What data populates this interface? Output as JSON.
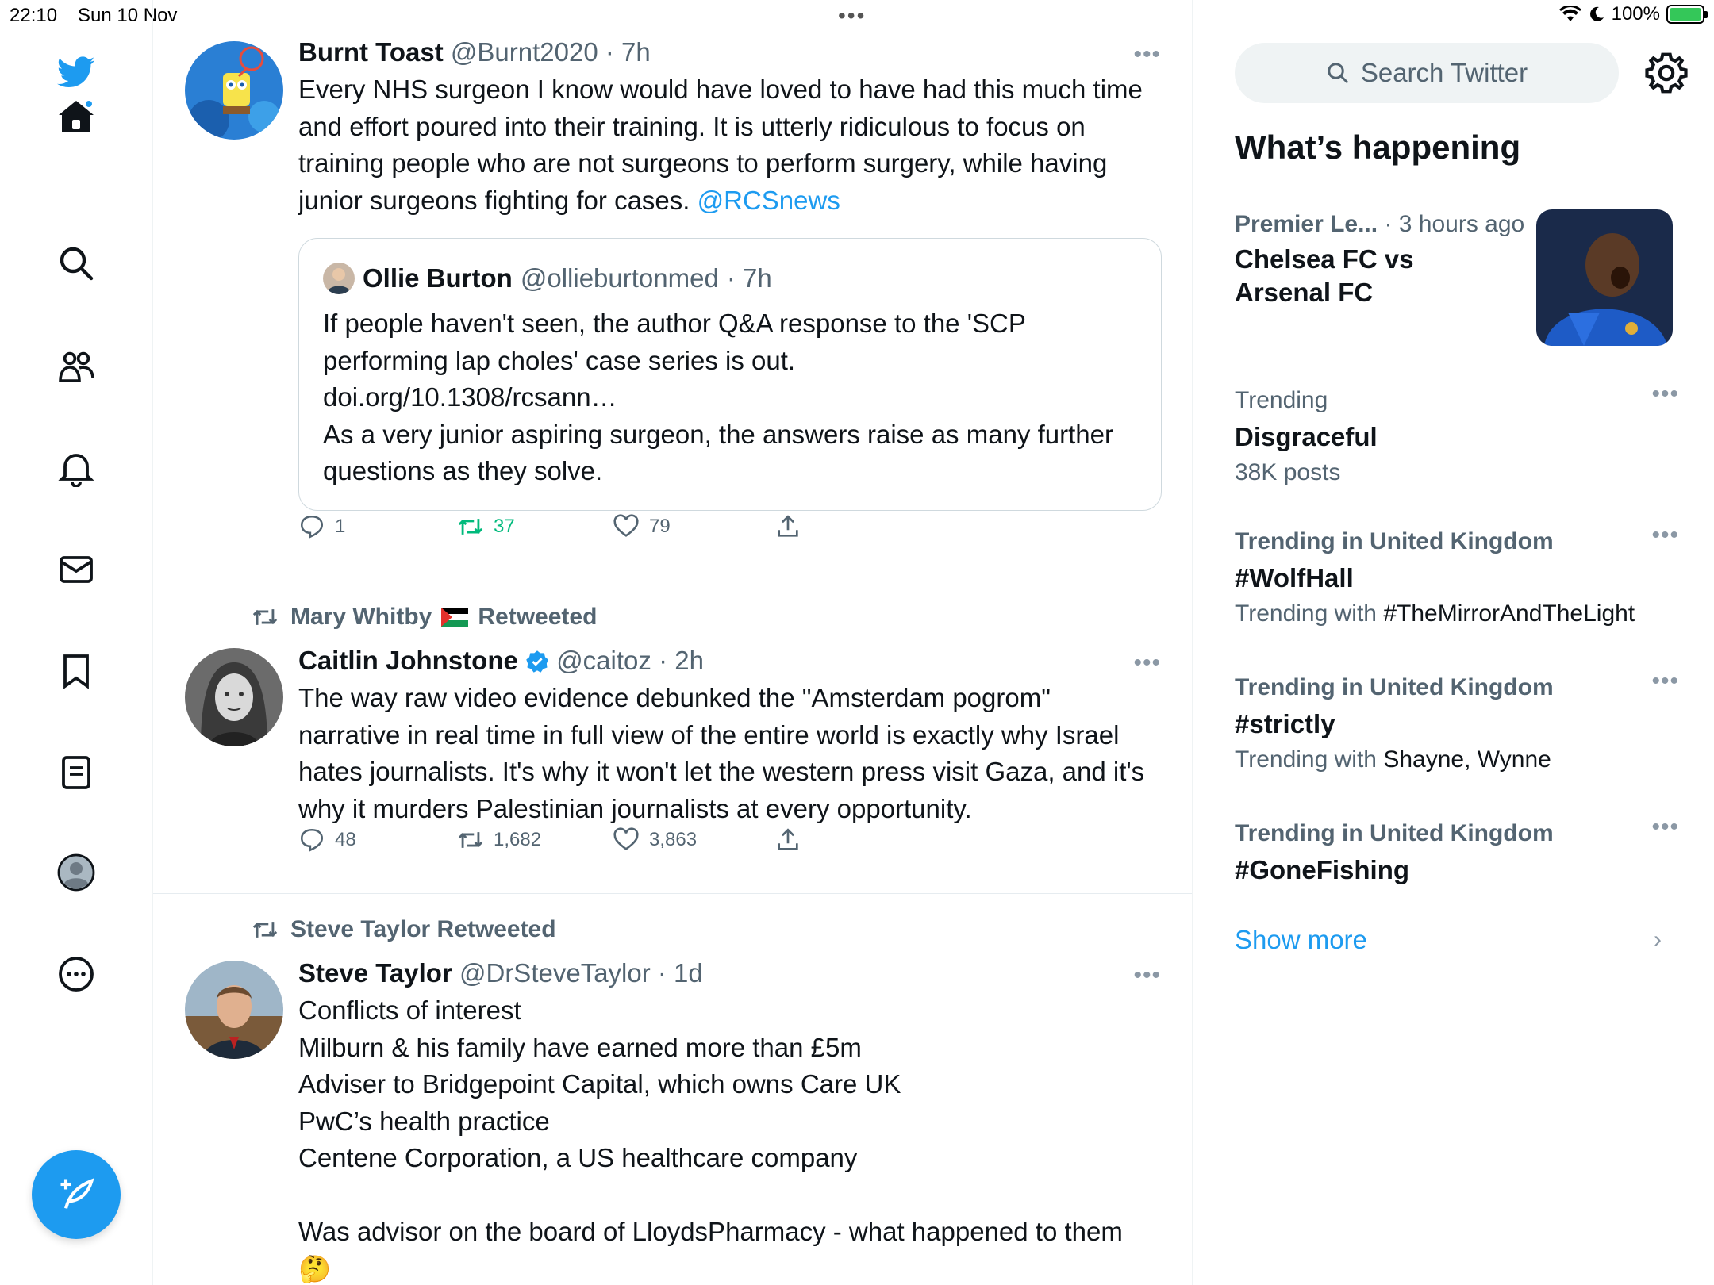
{
  "status_bar": {
    "time": "22:10",
    "date": "Sun 10 Nov",
    "battery": "100%"
  },
  "nav": {
    "icons": [
      "twitter-logo-icon",
      "home-icon",
      "search-icon",
      "communities-icon",
      "notifications-icon",
      "messages-icon",
      "bookmarks-icon",
      "lists-icon",
      "profile-icon",
      "more-icon"
    ],
    "compose_icon": "compose-icon",
    "accent": "#1d9bf0"
  },
  "timeline": {
    "tweets": [
      {
        "name": "Burnt Toast",
        "handle": "@Burnt2020",
        "time": "· 7h",
        "text": "Every NHS surgeon I know would have loved to have had this much time and effort poured into their training. It is utterly ridiculous to focus on training people who are not surgeons to perform surgery, while having junior surgeons fighting for cases.",
        "mention": "@RCSnews",
        "quote": {
          "name": "Ollie Burton",
          "handle": "@ollieburtonmed",
          "time": "· 7h",
          "line1": "If people haven't seen, the author Q&A response to the 'SCP performing lap choles' case series is out.",
          "line2": "doi.org/10.1308/rcsann…",
          "line3": "As a very junior aspiring surgeon, the answers raise as many further questions as they solve."
        },
        "replies": "1",
        "retweets": "37",
        "likes": "79"
      },
      {
        "retweeted_by": "Mary Whitby",
        "retweeted_label": "Retweeted",
        "name": "Caitlin Johnstone",
        "handle": "@caitoz",
        "time": "· 2h",
        "text": "The way raw video evidence debunked the \"Amsterdam pogrom\" narrative in real time in full view of the entire world is exactly why Israel hates journalists. It's why it won't let the western press visit Gaza, and it's why it murders Palestinian journalists at every opportunity.",
        "replies": "48",
        "retweets": "1,682",
        "likes": "3,863"
      },
      {
        "retweeted_by": "Steve Taylor Retweeted",
        "name": "Steve Taylor",
        "handle": "@DrSteveTaylor",
        "time": "· 1d",
        "lines": [
          "Conflicts of interest",
          "Milburn & his family have earned more than £5m",
          "Adviser to Bridgepoint Capital, which owns Care UK",
          "PwC’s health practice",
          "Centene Corporation, a US healthcare company",
          "",
          "Was advisor on the board of LloydsPharmacy - what happened to them"
        ],
        "emoji": "🤔"
      }
    ]
  },
  "sidebar": {
    "search_placeholder": "Search Twitter",
    "title": "What’s happening",
    "news": {
      "category": "Premier Le...",
      "time": "· 3 hours ago",
      "title_line1": "Chelsea FC vs",
      "title_line2": "Arsenal FC"
    },
    "trends": [
      {
        "meta": "Trending",
        "title": "Disgraceful",
        "sub": "38K posts"
      },
      {
        "meta": "Trending in United Kingdom",
        "title": "#WolfHall",
        "sub_prefix": "Trending with",
        "sub_value": "#TheMirrorAndTheLight"
      },
      {
        "meta": "Trending in United Kingdom",
        "title": "#strictly",
        "sub_prefix": "Trending with",
        "sub_value": "Shayne, Wynne"
      },
      {
        "meta": "Trending in United Kingdom",
        "title": "#GoneFishing"
      }
    ],
    "show_more": "Show more"
  }
}
